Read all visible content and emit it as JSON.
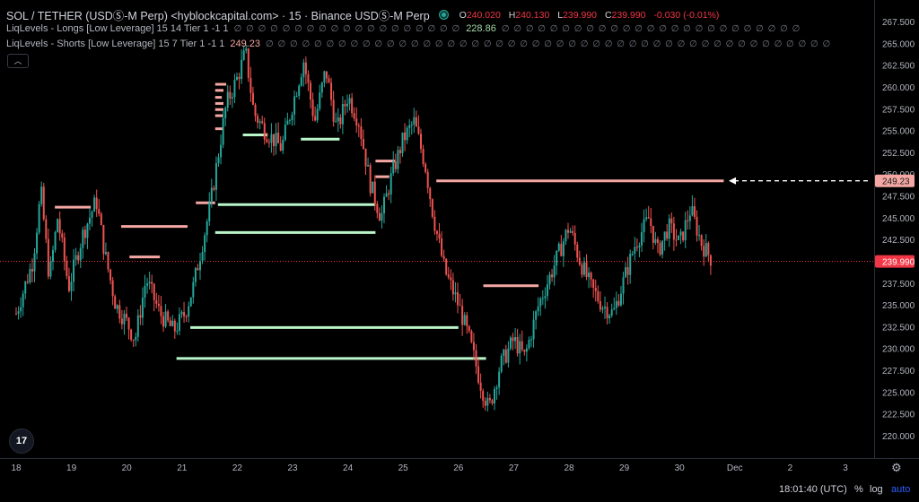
{
  "header": {
    "symbol": "SOL / TETHER (USDⓈ-M Perp) <hyblockcapital.com> · 15 · Binance USDⓈ-M Perp",
    "ohlc": {
      "o_label": "O",
      "o": "240.020",
      "h_label": "H",
      "h": "240.130",
      "l_label": "L",
      "l": "239.990",
      "c_label": "C",
      "c": "239.990",
      "change": "-0.030 (-0.01%)"
    }
  },
  "indicators": [
    {
      "name": "LiqLevels - Longs [Low Leverage] 15 14 Tier 1 -1 1",
      "dots_before": "∅ ∅ ∅ ∅ ∅ ∅ ∅ ∅ ∅ ∅ ∅ ∅ ∅ ∅ ∅ ∅ ∅ ∅ ∅",
      "value": "228.86",
      "dots_after": "∅ ∅ ∅ ∅ ∅ ∅ ∅ ∅ ∅ ∅ ∅ ∅ ∅ ∅ ∅ ∅ ∅ ∅ ∅ ∅ ∅ ∅ ∅ ∅ ∅"
    },
    {
      "name": "LiqLevels - Shorts [Low Leverage] 15 7 Tier 1 -1 1",
      "value": "249.23",
      "dots_after": "∅ ∅ ∅ ∅ ∅ ∅ ∅ ∅ ∅ ∅ ∅ ∅ ∅ ∅ ∅ ∅ ∅ ∅ ∅ ∅ ∅ ∅ ∅ ∅ ∅ ∅ ∅ ∅ ∅ ∅ ∅ ∅ ∅ ∅ ∅ ∅ ∅ ∅ ∅ ∅ ∅ ∅ ∅ ∅ ∅ ∅ ∅"
    }
  ],
  "collapse_icon": "chevron-up-icon",
  "colors": {
    "up": "#26a69a",
    "down": "#ef5350",
    "long_level": "#b9f6ca",
    "short_level": "#f4a7a3",
    "current_price_bg": "#f23645",
    "level_label_bg": "#f4a7a3"
  },
  "chart_data": {
    "type": "candlestick",
    "price_axis_ticks": [
      "267.500",
      "265.000",
      "262.500",
      "260.000",
      "257.500",
      "255.000",
      "252.500",
      "250.000",
      "247.500",
      "245.000",
      "242.500",
      "240.000",
      "237.500",
      "235.000",
      "232.500",
      "230.000",
      "227.500",
      "225.000",
      "222.500",
      "220.000"
    ],
    "time_axis_ticks": [
      "18",
      "19",
      "20",
      "21",
      "22",
      "23",
      "24",
      "25",
      "26",
      "27",
      "28",
      "29",
      "30",
      "Dec",
      "2",
      "3"
    ],
    "ylim": [
      218.0,
      268.8
    ],
    "current_price": "239.990",
    "current_price_line_label": "249.23",
    "price_path": [
      {
        "day": 18.0,
        "p": 234
      },
      {
        "day": 18.3,
        "p": 240
      },
      {
        "day": 18.45,
        "p": 248
      },
      {
        "day": 18.6,
        "p": 238
      },
      {
        "day": 18.75,
        "p": 245
      },
      {
        "day": 18.95,
        "p": 237
      },
      {
        "day": 19.2,
        "p": 243
      },
      {
        "day": 19.45,
        "p": 247
      },
      {
        "day": 19.6,
        "p": 241
      },
      {
        "day": 19.8,
        "p": 235
      },
      {
        "day": 20.0,
        "p": 233
      },
      {
        "day": 20.15,
        "p": 231
      },
      {
        "day": 20.35,
        "p": 238
      },
      {
        "day": 20.6,
        "p": 234
      },
      {
        "day": 20.85,
        "p": 232
      },
      {
        "day": 21.05,
        "p": 234
      },
      {
        "day": 21.2,
        "p": 237
      },
      {
        "day": 21.5,
        "p": 246
      },
      {
        "day": 21.65,
        "p": 252
      },
      {
        "day": 21.8,
        "p": 258
      },
      {
        "day": 22.0,
        "p": 261
      },
      {
        "day": 22.15,
        "p": 264
      },
      {
        "day": 22.3,
        "p": 257
      },
      {
        "day": 22.5,
        "p": 255
      },
      {
        "day": 22.8,
        "p": 253
      },
      {
        "day": 23.0,
        "p": 258
      },
      {
        "day": 23.2,
        "p": 263
      },
      {
        "day": 23.4,
        "p": 256
      },
      {
        "day": 23.6,
        "p": 262
      },
      {
        "day": 23.8,
        "p": 255
      },
      {
        "day": 24.0,
        "p": 259
      },
      {
        "day": 24.2,
        "p": 256
      },
      {
        "day": 24.4,
        "p": 249
      },
      {
        "day": 24.6,
        "p": 245
      },
      {
        "day": 24.8,
        "p": 250
      },
      {
        "day": 25.0,
        "p": 254
      },
      {
        "day": 25.2,
        "p": 256
      },
      {
        "day": 25.4,
        "p": 251
      },
      {
        "day": 25.55,
        "p": 245
      },
      {
        "day": 25.75,
        "p": 239
      },
      {
        "day": 26.0,
        "p": 235
      },
      {
        "day": 26.2,
        "p": 231
      },
      {
        "day": 26.4,
        "p": 226
      },
      {
        "day": 26.55,
        "p": 223
      },
      {
        "day": 26.75,
        "p": 228
      },
      {
        "day": 27.0,
        "p": 231
      },
      {
        "day": 27.2,
        "p": 229
      },
      {
        "day": 27.45,
        "p": 235
      },
      {
        "day": 27.7,
        "p": 239
      },
      {
        "day": 28.0,
        "p": 244
      },
      {
        "day": 28.2,
        "p": 240
      },
      {
        "day": 28.4,
        "p": 237
      },
      {
        "day": 28.6,
        "p": 235
      },
      {
        "day": 28.8,
        "p": 234
      },
      {
        "day": 29.0,
        "p": 238
      },
      {
        "day": 29.2,
        "p": 242
      },
      {
        "day": 29.45,
        "p": 245
      },
      {
        "day": 29.6,
        "p": 241
      },
      {
        "day": 29.8,
        "p": 244
      },
      {
        "day": 30.0,
        "p": 242
      },
      {
        "day": 30.2,
        "p": 246
      },
      {
        "day": 30.4,
        "p": 242
      },
      {
        "day": 30.6,
        "p": 240
      }
    ],
    "short_levels": [
      {
        "price": 246.2,
        "from": 18.7,
        "to": 19.35
      },
      {
        "price": 244.0,
        "from": 19.9,
        "to": 21.1
      },
      {
        "price": 240.5,
        "from": 20.05,
        "to": 20.6
      },
      {
        "price": 246.7,
        "from": 21.25,
        "to": 21.6
      },
      {
        "price": 260.3,
        "from": 21.6,
        "to": 21.8
      },
      {
        "price": 259.6,
        "from": 21.6,
        "to": 21.75
      },
      {
        "price": 258.8,
        "from": 21.6,
        "to": 21.72
      },
      {
        "price": 258.1,
        "from": 21.6,
        "to": 21.75
      },
      {
        "price": 257.4,
        "from": 21.6,
        "to": 21.75
      },
      {
        "price": 256.7,
        "from": 21.6,
        "to": 21.75
      },
      {
        "price": 255.2,
        "from": 21.6,
        "to": 21.75
      },
      {
        "price": 251.5,
        "from": 24.5,
        "to": 24.85
      },
      {
        "price": 249.7,
        "from": 24.5,
        "to": 24.75
      },
      {
        "price": 249.23,
        "from": 25.6,
        "to": 30.8
      },
      {
        "price": 237.2,
        "from": 26.45,
        "to": 27.45
      }
    ],
    "long_levels": [
      {
        "price": 246.5,
        "from": 21.65,
        "to": 24.5
      },
      {
        "price": 243.3,
        "from": 21.6,
        "to": 24.5
      },
      {
        "price": 254.5,
        "from": 22.1,
        "to": 22.55
      },
      {
        "price": 254.0,
        "from": 23.15,
        "to": 23.85
      },
      {
        "price": 232.4,
        "from": 21.15,
        "to": 26.0
      },
      {
        "price": 228.86,
        "from": 20.9,
        "to": 26.5
      }
    ],
    "grid": false
  },
  "footer": {
    "time": "18:01:40 (UTC)",
    "percent": "%",
    "log": "log",
    "auto": "auto"
  },
  "logo_text": "17",
  "settings_icon": "gear-icon"
}
